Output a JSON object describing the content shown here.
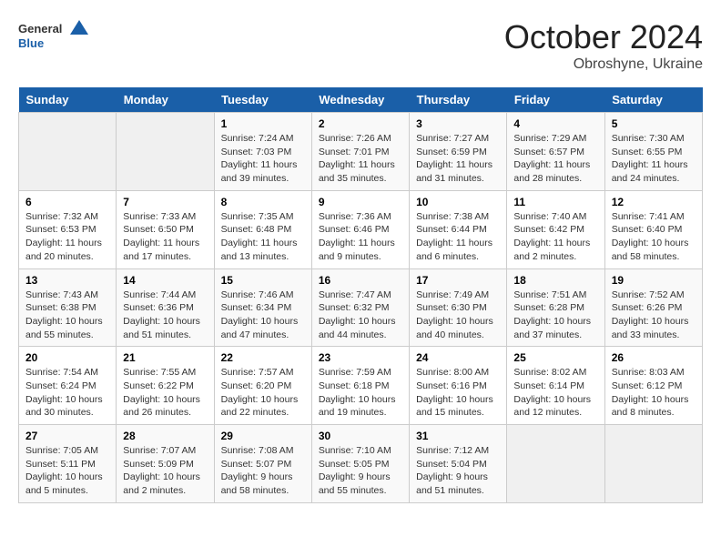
{
  "header": {
    "logo_line1": "General",
    "logo_line2": "Blue",
    "month": "October 2024",
    "location": "Obroshyne, Ukraine"
  },
  "weekdays": [
    "Sunday",
    "Monday",
    "Tuesday",
    "Wednesday",
    "Thursday",
    "Friday",
    "Saturday"
  ],
  "weeks": [
    [
      {
        "day": "",
        "empty": true
      },
      {
        "day": "",
        "empty": true
      },
      {
        "day": "1",
        "sunrise": "Sunrise: 7:24 AM",
        "sunset": "Sunset: 7:03 PM",
        "daylight": "Daylight: 11 hours and 39 minutes."
      },
      {
        "day": "2",
        "sunrise": "Sunrise: 7:26 AM",
        "sunset": "Sunset: 7:01 PM",
        "daylight": "Daylight: 11 hours and 35 minutes."
      },
      {
        "day": "3",
        "sunrise": "Sunrise: 7:27 AM",
        "sunset": "Sunset: 6:59 PM",
        "daylight": "Daylight: 11 hours and 31 minutes."
      },
      {
        "day": "4",
        "sunrise": "Sunrise: 7:29 AM",
        "sunset": "Sunset: 6:57 PM",
        "daylight": "Daylight: 11 hours and 28 minutes."
      },
      {
        "day": "5",
        "sunrise": "Sunrise: 7:30 AM",
        "sunset": "Sunset: 6:55 PM",
        "daylight": "Daylight: 11 hours and 24 minutes."
      }
    ],
    [
      {
        "day": "6",
        "sunrise": "Sunrise: 7:32 AM",
        "sunset": "Sunset: 6:53 PM",
        "daylight": "Daylight: 11 hours and 20 minutes."
      },
      {
        "day": "7",
        "sunrise": "Sunrise: 7:33 AM",
        "sunset": "Sunset: 6:50 PM",
        "daylight": "Daylight: 11 hours and 17 minutes."
      },
      {
        "day": "8",
        "sunrise": "Sunrise: 7:35 AM",
        "sunset": "Sunset: 6:48 PM",
        "daylight": "Daylight: 11 hours and 13 minutes."
      },
      {
        "day": "9",
        "sunrise": "Sunrise: 7:36 AM",
        "sunset": "Sunset: 6:46 PM",
        "daylight": "Daylight: 11 hours and 9 minutes."
      },
      {
        "day": "10",
        "sunrise": "Sunrise: 7:38 AM",
        "sunset": "Sunset: 6:44 PM",
        "daylight": "Daylight: 11 hours and 6 minutes."
      },
      {
        "day": "11",
        "sunrise": "Sunrise: 7:40 AM",
        "sunset": "Sunset: 6:42 PM",
        "daylight": "Daylight: 11 hours and 2 minutes."
      },
      {
        "day": "12",
        "sunrise": "Sunrise: 7:41 AM",
        "sunset": "Sunset: 6:40 PM",
        "daylight": "Daylight: 10 hours and 58 minutes."
      }
    ],
    [
      {
        "day": "13",
        "sunrise": "Sunrise: 7:43 AM",
        "sunset": "Sunset: 6:38 PM",
        "daylight": "Daylight: 10 hours and 55 minutes."
      },
      {
        "day": "14",
        "sunrise": "Sunrise: 7:44 AM",
        "sunset": "Sunset: 6:36 PM",
        "daylight": "Daylight: 10 hours and 51 minutes."
      },
      {
        "day": "15",
        "sunrise": "Sunrise: 7:46 AM",
        "sunset": "Sunset: 6:34 PM",
        "daylight": "Daylight: 10 hours and 47 minutes."
      },
      {
        "day": "16",
        "sunrise": "Sunrise: 7:47 AM",
        "sunset": "Sunset: 6:32 PM",
        "daylight": "Daylight: 10 hours and 44 minutes."
      },
      {
        "day": "17",
        "sunrise": "Sunrise: 7:49 AM",
        "sunset": "Sunset: 6:30 PM",
        "daylight": "Daylight: 10 hours and 40 minutes."
      },
      {
        "day": "18",
        "sunrise": "Sunrise: 7:51 AM",
        "sunset": "Sunset: 6:28 PM",
        "daylight": "Daylight: 10 hours and 37 minutes."
      },
      {
        "day": "19",
        "sunrise": "Sunrise: 7:52 AM",
        "sunset": "Sunset: 6:26 PM",
        "daylight": "Daylight: 10 hours and 33 minutes."
      }
    ],
    [
      {
        "day": "20",
        "sunrise": "Sunrise: 7:54 AM",
        "sunset": "Sunset: 6:24 PM",
        "daylight": "Daylight: 10 hours and 30 minutes."
      },
      {
        "day": "21",
        "sunrise": "Sunrise: 7:55 AM",
        "sunset": "Sunset: 6:22 PM",
        "daylight": "Daylight: 10 hours and 26 minutes."
      },
      {
        "day": "22",
        "sunrise": "Sunrise: 7:57 AM",
        "sunset": "Sunset: 6:20 PM",
        "daylight": "Daylight: 10 hours and 22 minutes."
      },
      {
        "day": "23",
        "sunrise": "Sunrise: 7:59 AM",
        "sunset": "Sunset: 6:18 PM",
        "daylight": "Daylight: 10 hours and 19 minutes."
      },
      {
        "day": "24",
        "sunrise": "Sunrise: 8:00 AM",
        "sunset": "Sunset: 6:16 PM",
        "daylight": "Daylight: 10 hours and 15 minutes."
      },
      {
        "day": "25",
        "sunrise": "Sunrise: 8:02 AM",
        "sunset": "Sunset: 6:14 PM",
        "daylight": "Daylight: 10 hours and 12 minutes."
      },
      {
        "day": "26",
        "sunrise": "Sunrise: 8:03 AM",
        "sunset": "Sunset: 6:12 PM",
        "daylight": "Daylight: 10 hours and 8 minutes."
      }
    ],
    [
      {
        "day": "27",
        "sunrise": "Sunrise: 7:05 AM",
        "sunset": "Sunset: 5:11 PM",
        "daylight": "Daylight: 10 hours and 5 minutes."
      },
      {
        "day": "28",
        "sunrise": "Sunrise: 7:07 AM",
        "sunset": "Sunset: 5:09 PM",
        "daylight": "Daylight: 10 hours and 2 minutes."
      },
      {
        "day": "29",
        "sunrise": "Sunrise: 7:08 AM",
        "sunset": "Sunset: 5:07 PM",
        "daylight": "Daylight: 9 hours and 58 minutes."
      },
      {
        "day": "30",
        "sunrise": "Sunrise: 7:10 AM",
        "sunset": "Sunset: 5:05 PM",
        "daylight": "Daylight: 9 hours and 55 minutes."
      },
      {
        "day": "31",
        "sunrise": "Sunrise: 7:12 AM",
        "sunset": "Sunset: 5:04 PM",
        "daylight": "Daylight: 9 hours and 51 minutes."
      },
      {
        "day": "",
        "empty": true
      },
      {
        "day": "",
        "empty": true
      }
    ]
  ]
}
